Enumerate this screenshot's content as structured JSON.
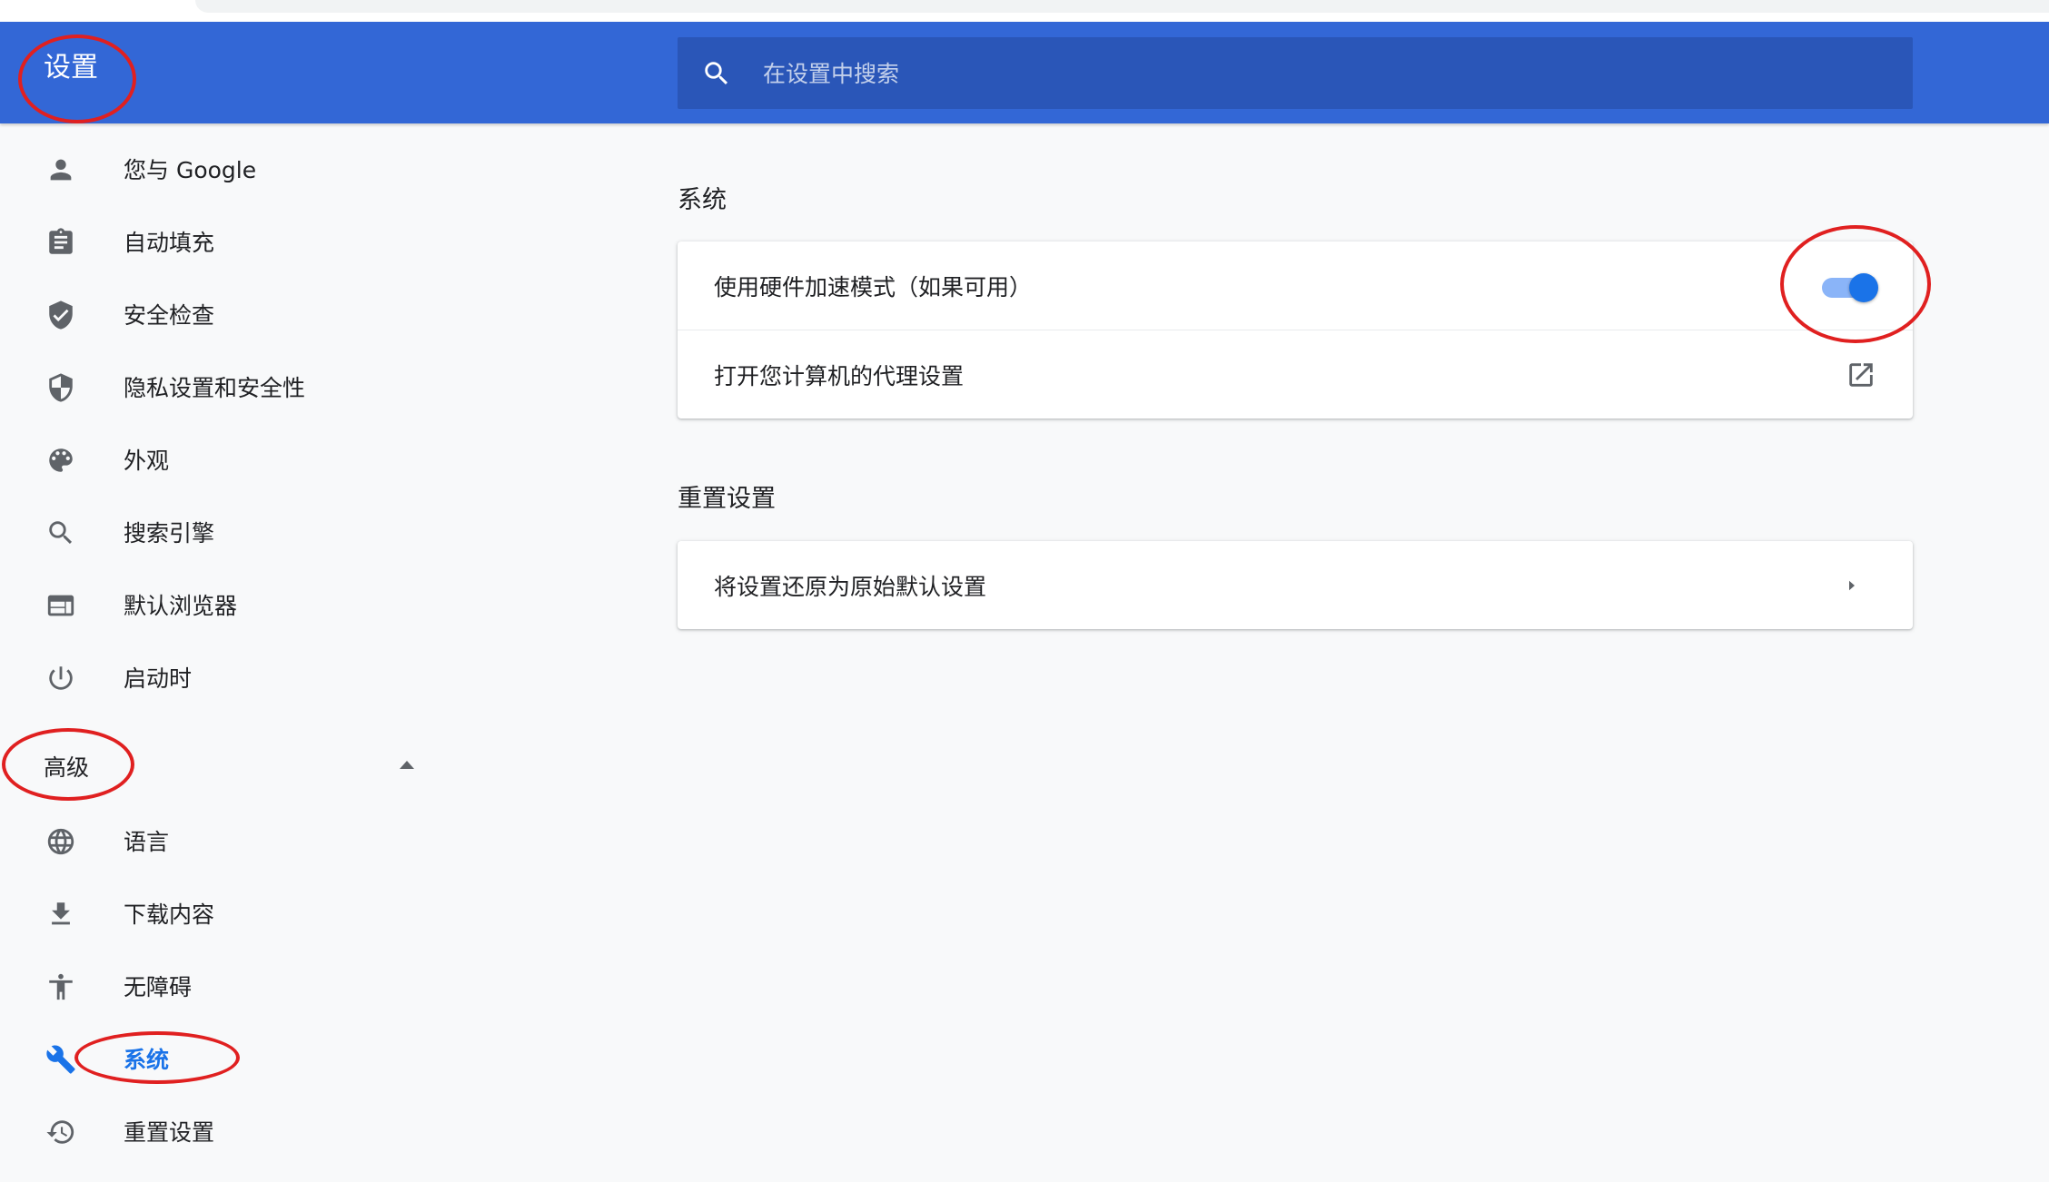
{
  "header": {
    "title": "设置",
    "search": {
      "placeholder": "在设置中搜索",
      "value": ""
    }
  },
  "sidebar": {
    "items": [
      {
        "label": "您与 Google",
        "icon": "person-icon"
      },
      {
        "label": "自动填充",
        "icon": "clipboard-icon"
      },
      {
        "label": "安全检查",
        "icon": "shield-check-icon"
      },
      {
        "label": "隐私设置和安全性",
        "icon": "shield-half-icon"
      },
      {
        "label": "外观",
        "icon": "palette-icon"
      },
      {
        "label": "搜索引擎",
        "icon": "search-icon"
      },
      {
        "label": "默认浏览器",
        "icon": "browser-window-icon"
      },
      {
        "label": "启动时",
        "icon": "power-icon"
      }
    ],
    "advanced": {
      "label": "高级",
      "expanded": true
    },
    "advanced_items": [
      {
        "label": "语言",
        "icon": "globe-icon"
      },
      {
        "label": "下载内容",
        "icon": "download-icon"
      },
      {
        "label": "无障碍",
        "icon": "accessibility-icon"
      },
      {
        "label": "系统",
        "icon": "wrench-icon",
        "active": true
      },
      {
        "label": "重置设置",
        "icon": "restore-icon"
      }
    ]
  },
  "main": {
    "system": {
      "title": "系统",
      "rows": [
        {
          "label": "使用硬件加速模式（如果可用）",
          "control": "toggle",
          "enabled": true
        },
        {
          "label": "打开您计算机的代理设置",
          "control": "external-link-icon"
        }
      ]
    },
    "reset": {
      "title": "重置设置",
      "rows": [
        {
          "label": "将设置还原为原始默认设置",
          "control": "chevron-right-icon"
        }
      ]
    }
  },
  "colors": {
    "header_bg": "#3367d6",
    "search_bg": "#2a56b8",
    "accent": "#1a73e8",
    "annotation": "#e02020"
  }
}
